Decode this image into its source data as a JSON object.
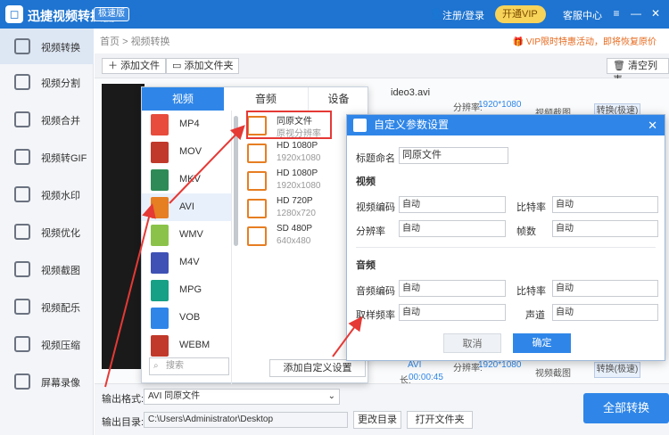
{
  "app": {
    "title": "迅捷视频转换器",
    "version_badge": "极速版",
    "login": "注册/登录",
    "vip": "开通VIP",
    "service": "客服中心"
  },
  "sidebar": {
    "items": [
      {
        "label": "视频转换",
        "active": true
      },
      {
        "label": "视频分割"
      },
      {
        "label": "视频合并"
      },
      {
        "label": "视频转GIF"
      },
      {
        "label": "视频水印"
      },
      {
        "label": "视频优化"
      },
      {
        "label": "视频截图"
      },
      {
        "label": "视频配乐"
      },
      {
        "label": "视频压缩"
      },
      {
        "label": "屏幕录像"
      }
    ]
  },
  "breadcrumb": {
    "home": "首页",
    "sep": ">",
    "current": "视频转换"
  },
  "notice": "VIP限时特惠活动，即将恢复原价",
  "toolbar": {
    "add_file": "添加文件",
    "add_folder": "添加文件夹",
    "clear": "清空列表"
  },
  "rows": {
    "filename": "ideo3.avi",
    "resolution_label": "分辨率:",
    "resolution": "1920*1080",
    "screenshot": "视频截图",
    "convert": "转换(极速)",
    "format_value": "AVI",
    "duration_label": "长:",
    "duration": "00:00:45"
  },
  "popup": {
    "tabs": [
      "视频",
      "音频",
      "设备"
    ],
    "formats": [
      {
        "name": "MP4",
        "color": "#e74c3c"
      },
      {
        "name": "MOV",
        "color": "#c0392b"
      },
      {
        "name": "MKV",
        "color": "#2e8b57"
      },
      {
        "name": "AVI",
        "color": "#e67e22"
      },
      {
        "name": "WMV",
        "color": "#8bc34a"
      },
      {
        "name": "M4V",
        "color": "#3f51b5"
      },
      {
        "name": "MPG",
        "color": "#16a085"
      },
      {
        "name": "VOB",
        "color": "#2f86e8"
      },
      {
        "name": "WEBM",
        "color": "#c0392b"
      }
    ],
    "search_placeholder": "搜索",
    "presets": [
      {
        "name": "同原文件",
        "res": "原视分辨率"
      },
      {
        "name": "HD 1080P",
        "res": "1920x1080"
      },
      {
        "name": "HD 1080P",
        "res": "1920x1080"
      },
      {
        "name": "HD 720P",
        "res": "1280x720"
      },
      {
        "name": "SD 480P",
        "res": "640x480"
      }
    ],
    "add_custom": "添加自定义设置"
  },
  "dialog": {
    "title": "自定义参数设置",
    "name_label": "标题命名",
    "name_value": "同原文件",
    "video_section": "视频",
    "video_codec": "视频编码",
    "bitrate": "比特率",
    "resolution": "分辨率",
    "fps": "帧数",
    "audio_section": "音频",
    "audio_codec": "音频编码",
    "audio_bitrate": "比特率",
    "sample_rate": "取样频率",
    "channel": "声道",
    "auto": "自动",
    "cancel": "取消",
    "ok": "确定"
  },
  "bottom": {
    "format_label": "输出格式:",
    "format_value": "AVI  同原文件",
    "dir_label": "输出目录:",
    "dir_value": "C:\\Users\\Administrator\\Desktop",
    "change_dir": "更改目录",
    "open_folder": "打开文件夹",
    "convert_all": "全部转换"
  },
  "colors": {
    "primary": "#2f86e8",
    "titlebar": "#1e74d0",
    "accent": "#e53935"
  }
}
